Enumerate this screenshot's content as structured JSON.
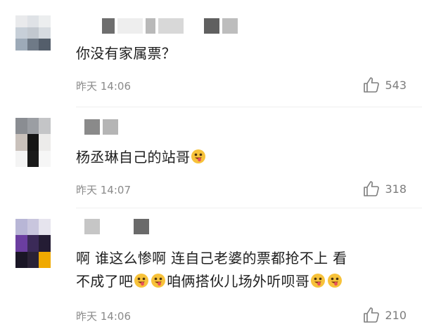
{
  "comments": [
    {
      "text_lines": [
        "你没有家属票？"
      ],
      "time": "昨天 14:06",
      "likes": "543",
      "emojis_after": 0
    },
    {
      "text_lines": [
        "杨丞琳自己的站哥"
      ],
      "time": "昨天 14:07",
      "likes": "318",
      "emojis_after": 1
    },
    {
      "text_lines": [
        "啊 谁这么惨啊 连自己老婆的票都抢不上 看",
        "不成了吧",
        "咱俩搭伙儿场外听呗哥"
      ],
      "time": "昨天 14:06",
      "likes": "210"
    }
  ],
  "icons": {
    "like": "thumbs-up-icon",
    "emoji": "tongue-out-face-icon"
  },
  "colors": {
    "text": "#202020",
    "meta": "#8a8a8a",
    "emoji_face": "#f7c23a"
  }
}
